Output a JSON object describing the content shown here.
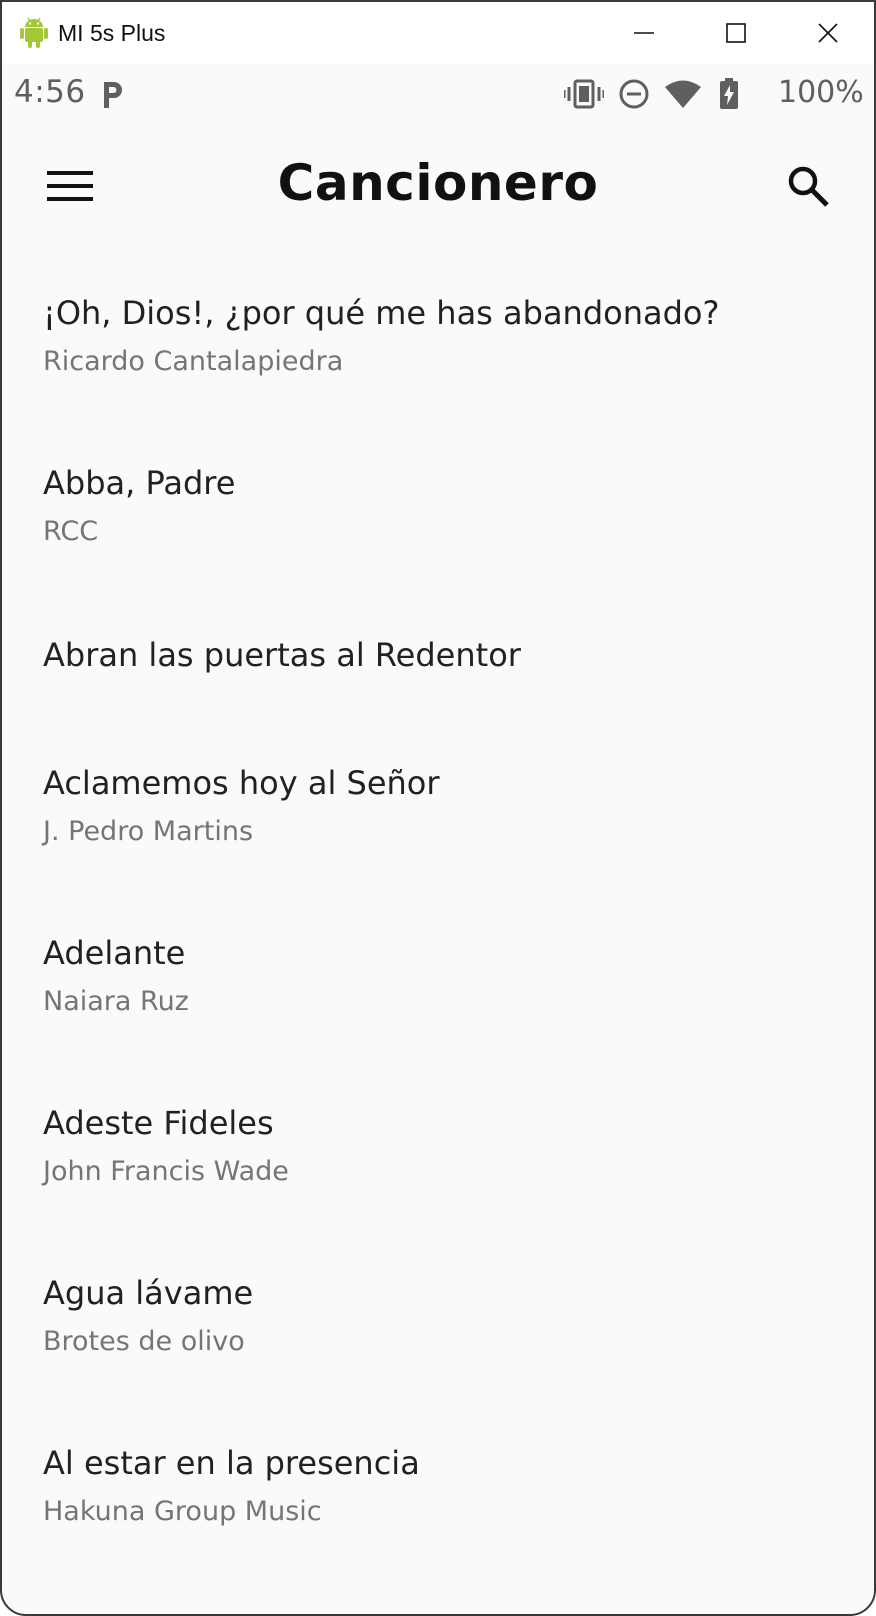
{
  "window": {
    "title": "MI 5s Plus",
    "icon": "android-icon"
  },
  "statusbar": {
    "time": "4:56",
    "battery": "100%"
  },
  "appbar": {
    "title": "Cancionero",
    "menu_icon": "menu-icon",
    "search_icon": "search-icon"
  },
  "songs": [
    {
      "title": "¡Oh, Dios!, ¿por qué me has abandonado?",
      "author": "Ricardo Cantalapiedra"
    },
    {
      "title": "Abba, Padre",
      "author": "RCC"
    },
    {
      "title": "Abran las puertas al Redentor",
      "author": ""
    },
    {
      "title": "Aclamemos hoy al Señor",
      "author": "J. Pedro Martins"
    },
    {
      "title": "Adelante",
      "author": "Naiara Ruz"
    },
    {
      "title": "Adeste Fideles",
      "author": "John Francis Wade"
    },
    {
      "title": "Agua lávame",
      "author": "Brotes de olivo"
    },
    {
      "title": "Al estar en la presencia",
      "author": "Hakuna Group Music"
    }
  ],
  "colors": {
    "background": "#fafafa",
    "title_text": "#212121",
    "subtitle_text": "#757575",
    "android_green": "#a4c639"
  }
}
